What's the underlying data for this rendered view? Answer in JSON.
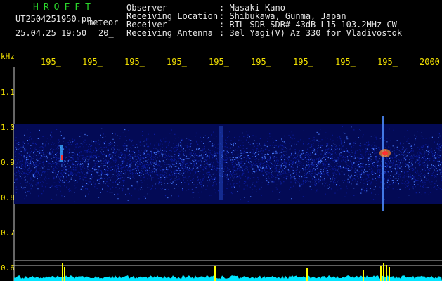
{
  "header": {
    "app_name": "HROFFT",
    "file_name": "UT2504251950.pn_",
    "event_type": "meteor",
    "datetime": "25.04.25 19:50",
    "minute_range": "20_",
    "info_labels": [
      "Observer",
      "Receiving Location",
      "Receiver",
      "Receiving Antenna"
    ],
    "info_values": [
      ": Masaki Kano",
      ": Shibukawa, Gunma, Japan",
      ": RTL-SDR SDR# 43dB L15 103.2MHz CW",
      ": 3el Yagi(V) Az 330 for Vladivostok"
    ]
  },
  "axis": {
    "unit": "kHz",
    "x_ticks": [
      "195_",
      "195_",
      "195_",
      "195_",
      "195_",
      "195_",
      "195_",
      "195_",
      "195_",
      "2000"
    ],
    "y_ticks": [
      "1.1",
      "1.0",
      "0.9",
      "0.8",
      "0.7",
      "0.6"
    ]
  },
  "colors": {
    "background": "#000000",
    "header_text": "#e8e8e8",
    "app_name": "#2bd62b",
    "axis_text": "#f2e000",
    "noise_dark": "#0a1a9a",
    "noise_light": "#4a7cff",
    "echo_red": "#ff3030",
    "spectrum": "#00e5ff",
    "spikes": "#ffff00"
  }
}
